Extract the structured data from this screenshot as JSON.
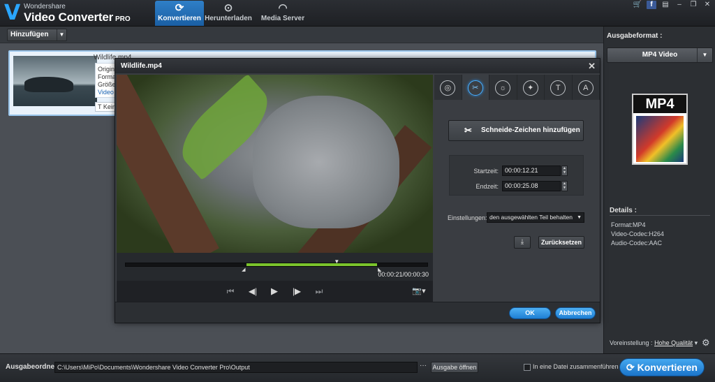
{
  "app": {
    "vendor": "Wondershare",
    "product": "Video Converter",
    "edition": "PRO",
    "logo_glyph": "V"
  },
  "tabs": [
    {
      "label": "Konvertieren",
      "icon": "refresh-icon",
      "glyph": "⟳",
      "active": true
    },
    {
      "label": "Herunterladen",
      "icon": "download-icon",
      "glyph": "⊙",
      "active": false
    },
    {
      "label": "Media Server",
      "icon": "wifi-icon",
      "glyph": "◠",
      "active": false
    }
  ],
  "top_icons": {
    "cart": "🛒",
    "facebook": "f",
    "notes": "▤",
    "minimize": "‒",
    "maximize": "❐",
    "close": "✕"
  },
  "toolbar": {
    "add_label": "Hinzufügen",
    "add_dropdown": "▼"
  },
  "file": {
    "name": "Wildlife.mp4",
    "meta_lines": [
      "Origina",
      "Forma",
      "Größe"
    ],
    "meta_link": "Video",
    "subtitle_button": "T Kein"
  },
  "right_panel": {
    "title": "Ausgabeformat :",
    "format": "MP4 Video",
    "format_dropdown": "▼",
    "thumb_label": "MP4",
    "details_title": "Details :",
    "details": {
      "format": "Format:MP4",
      "video_codec": "Video-Codec:H264",
      "audio_codec": "Audio-Codec:AAC"
    },
    "preset_label": "Voreinstellung :",
    "preset_value": "Hohe Qualität",
    "gear": "⚙"
  },
  "bottom": {
    "out_label": "Ausgabeordner",
    "out_path": "C:\\Users\\MiPo\\Documents\\Wondershare Video Converter Pro\\Output",
    "dots": "···",
    "open_output": "Ausgabe öffnen",
    "merge_label": "In eine Datei zusammenführen",
    "convert_label": "Konvertieren",
    "convert_glyph": "⟳"
  },
  "dialog": {
    "title": "Wildlife.mp4",
    "close": "✕",
    "tools": [
      {
        "name": "crop-tool-icon",
        "glyph": "◎",
        "active": false
      },
      {
        "name": "scissors-tool-icon",
        "glyph": "✂",
        "active": true
      },
      {
        "name": "brightness-tool-icon",
        "glyph": "☼",
        "active": false
      },
      {
        "name": "magic-wand-tool-icon",
        "glyph": "✦",
        "active": false
      },
      {
        "name": "subtitle-tool-icon",
        "glyph": "T",
        "active": false
      },
      {
        "name": "watermark-tool-icon",
        "glyph": "A",
        "active": false
      }
    ],
    "cutmark_label": "Schneide-Zeichen hinzufügen",
    "cutmark_glyph": "✂",
    "start_label": "Startzeit:",
    "start_value": "00:00:12.21",
    "end_label": "Endzeit:",
    "end_value": "00:00:25.08",
    "settings_label": "Einstellungen:",
    "settings_value": "den ausgewählten Teil behalten",
    "settings_dropdown": "▼",
    "export_glyph": "⤓",
    "reset_label": "Zurücksetzen",
    "ok_label": "OK",
    "cancel_label": "Abbrechen",
    "time_readout": "00:00:21/00:00:30",
    "selection_start_fraction": 0.4,
    "selection_end_fraction": 0.833,
    "playhead_fraction": 0.7,
    "controls": {
      "first": "⏮",
      "step_back": "◀|",
      "play": "▶",
      "step_forward": "|▶",
      "last": "⏭",
      "snapshot": "📷▾"
    }
  },
  "colors": {
    "accent_blue": "#1b74c9",
    "selection_green": "#7bc42c"
  }
}
